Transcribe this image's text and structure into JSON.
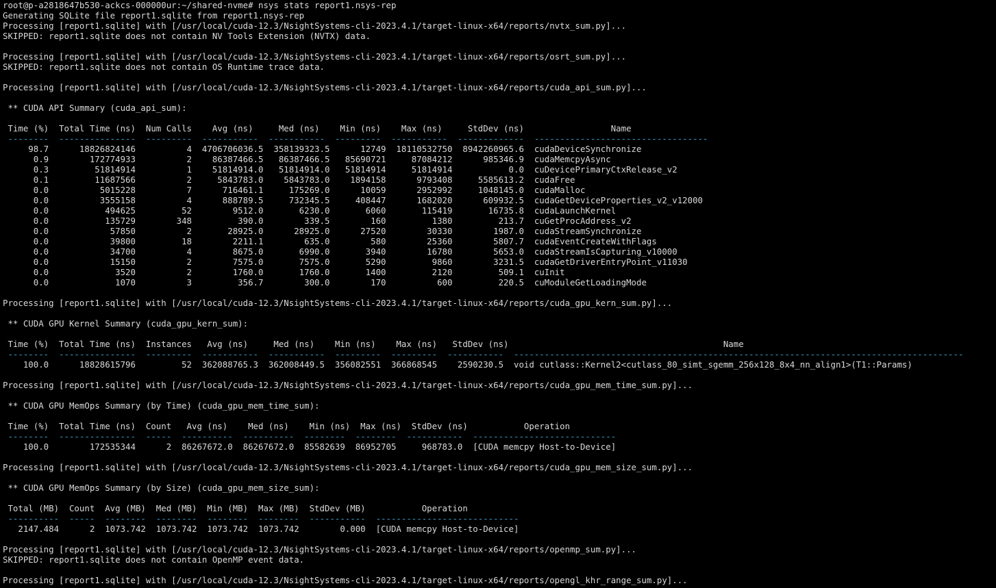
{
  "terminal": {
    "background": "#000000",
    "foreground": "#d9d9d9",
    "dash_color": "#3aa0c8",
    "lines": [
      {
        "text": "root@p-a2818647b530-ackcs-000000ur:~/shared-nvme# nsys stats report1.nsys-rep",
        "style": "normal"
      },
      {
        "text": "Generating SQLite file report1.sqlite from report1.nsys-rep",
        "style": "normal"
      },
      {
        "text": "Processing [report1.sqlite] with [/usr/local/cuda-12.3/NsightSystems-cli-2023.4.1/target-linux-x64/reports/nvtx_sum.py]...",
        "style": "normal"
      },
      {
        "text": "SKIPPED: report1.sqlite does not contain NV Tools Extension (NVTX) data.",
        "style": "normal"
      },
      {
        "text": "",
        "style": "normal"
      },
      {
        "text": "Processing [report1.sqlite] with [/usr/local/cuda-12.3/NsightSystems-cli-2023.4.1/target-linux-x64/reports/osrt_sum.py]...",
        "style": "normal"
      },
      {
        "text": "SKIPPED: report1.sqlite does not contain OS Runtime trace data.",
        "style": "normal"
      },
      {
        "text": "",
        "style": "normal"
      },
      {
        "text": "Processing [report1.sqlite] with [/usr/local/cuda-12.3/NsightSystems-cli-2023.4.1/target-linux-x64/reports/cuda_api_sum.py]...",
        "style": "normal"
      },
      {
        "text": "",
        "style": "normal"
      },
      {
        "text": " ** CUDA API Summary (cuda_api_sum):",
        "style": "normal"
      },
      {
        "text": "",
        "style": "normal"
      },
      {
        "text": " Time (%)  Total Time (ns)  Num Calls    Avg (ns)     Med (ns)    Min (ns)    Max (ns)     StdDev (ns)                 Name",
        "style": "normal"
      },
      {
        "text": " --------  ---------------  ---------  -----------  -----------  ---------  -----------  -------------  ----------------------------------",
        "style": "dash"
      },
      {
        "text": "     98.7      18826824146          4  4706706036.5  358139323.5      12749  18110532750  8942260965.6  cudaDeviceSynchronize",
        "style": "normal"
      },
      {
        "text": "      0.9        172774933          2    86387466.5   86387466.5   85690721     87084212      985346.9  cudaMemcpyAsync",
        "style": "normal"
      },
      {
        "text": "      0.3         51814914          1    51814914.0   51814914.0   51814914     51814914           0.0  cuDevicePrimaryCtxRelease_v2",
        "style": "normal"
      },
      {
        "text": "      0.1         11687566          2     5843783.0    5843783.0    1894158      9793408     5585613.2  cudaFree",
        "style": "normal"
      },
      {
        "text": "      0.0          5015228          7      716461.1     175269.0      10059      2952992     1048145.0  cudaMalloc",
        "style": "normal"
      },
      {
        "text": "      0.0          3555158          4      888789.5     732345.5     408447      1682020      609932.5  cudaGetDeviceProperties_v2_v12000",
        "style": "normal"
      },
      {
        "text": "      0.0           494625         52        9512.0       6230.0       6060       115419       16735.8  cudaLaunchKernel",
        "style": "normal"
      },
      {
        "text": "      0.0           135729        348         390.0        339.5        160         1380         213.7  cuGetProcAddress_v2",
        "style": "normal"
      },
      {
        "text": "      0.0            57850          2       28925.0      28925.0      27520        30330        1987.0  cudaStreamSynchronize",
        "style": "normal"
      },
      {
        "text": "      0.0            39800         18        2211.1        635.0        580        25360        5807.7  cudaEventCreateWithFlags",
        "style": "normal"
      },
      {
        "text": "      0.0            34700          4        8675.0       6990.0       3940        16780        5653.0  cudaStreamIsCapturing_v10000",
        "style": "normal"
      },
      {
        "text": "      0.0            15150          2        7575.0       7575.0       5290         9860        3231.5  cudaGetDriverEntryPoint_v11030",
        "style": "normal"
      },
      {
        "text": "      0.0             3520          2        1760.0       1760.0       1400         2120         509.1  cuInit",
        "style": "normal"
      },
      {
        "text": "      0.0             1070          3         356.7        300.0        170          600         220.5  cuModuleGetLoadingMode",
        "style": "normal"
      },
      {
        "text": "",
        "style": "normal"
      },
      {
        "text": "Processing [report1.sqlite] with [/usr/local/cuda-12.3/NsightSystems-cli-2023.4.1/target-linux-x64/reports/cuda_gpu_kern_sum.py]...",
        "style": "normal"
      },
      {
        "text": "",
        "style": "normal"
      },
      {
        "text": " ** CUDA GPU Kernel Summary (cuda_gpu_kern_sum):",
        "style": "normal"
      },
      {
        "text": "",
        "style": "normal"
      },
      {
        "text": " Time (%)  Total Time (ns)  Instances   Avg (ns)     Med (ns)    Min (ns)    Max (ns)   StdDev (ns)                                          Name",
        "style": "normal"
      },
      {
        "text": " --------  ---------------  ---------  -----------  -----------  ---------  ---------  -----------  ----------------------------------------------------------------------------------------",
        "style": "dash"
      },
      {
        "text": "    100.0      18828615796         52  362088765.3  362008449.5  356082551  366868545    2590230.5  void cutlass::Kernel2<cutlass_80_simt_sgemm_256x128_8x4_nn_align1>(T1::Params)",
        "style": "normal"
      },
      {
        "text": "",
        "style": "normal"
      },
      {
        "text": "Processing [report1.sqlite] with [/usr/local/cuda-12.3/NsightSystems-cli-2023.4.1/target-linux-x64/reports/cuda_gpu_mem_time_sum.py]...",
        "style": "normal"
      },
      {
        "text": "",
        "style": "normal"
      },
      {
        "text": " ** CUDA GPU MemOps Summary (by Time) (cuda_gpu_mem_time_sum):",
        "style": "normal"
      },
      {
        "text": "",
        "style": "normal"
      },
      {
        "text": " Time (%)  Total Time (ns)  Count   Avg (ns)    Med (ns)    Min (ns)  Max (ns)  StdDev (ns)           Operation",
        "style": "normal"
      },
      {
        "text": " --------  ---------------  -----  ----------  ----------  --------  --------  -----------  ----------------------------",
        "style": "dash"
      },
      {
        "text": "    100.0        172535344      2  86267672.0  86267672.0  85582639  86952705     968783.0  [CUDA memcpy Host-to-Device]",
        "style": "normal"
      },
      {
        "text": "",
        "style": "normal"
      },
      {
        "text": "Processing [report1.sqlite] with [/usr/local/cuda-12.3/NsightSystems-cli-2023.4.1/target-linux-x64/reports/cuda_gpu_mem_size_sum.py]...",
        "style": "normal"
      },
      {
        "text": "",
        "style": "normal"
      },
      {
        "text": " ** CUDA GPU MemOps Summary (by Size) (cuda_gpu_mem_size_sum):",
        "style": "normal"
      },
      {
        "text": "",
        "style": "normal"
      },
      {
        "text": " Total (MB)  Count  Avg (MB)  Med (MB)  Min (MB)  Max (MB)  StdDev (MB)           Operation",
        "style": "normal"
      },
      {
        "text": " ----------  -----  --------  --------  --------  --------  -----------  ----------------------------",
        "style": "dash"
      },
      {
        "text": "   2147.484      2  1073.742  1073.742  1073.742  1073.742        0.000  [CUDA memcpy Host-to-Device]",
        "style": "normal"
      },
      {
        "text": "",
        "style": "normal"
      },
      {
        "text": "Processing [report1.sqlite] with [/usr/local/cuda-12.3/NsightSystems-cli-2023.4.1/target-linux-x64/reports/openmp_sum.py]...",
        "style": "normal"
      },
      {
        "text": "SKIPPED: report1.sqlite does not contain OpenMP event data.",
        "style": "normal"
      },
      {
        "text": "",
        "style": "normal"
      },
      {
        "text": "Processing [report1.sqlite] with [/usr/local/cuda-12.3/NsightSystems-cli-2023.4.1/target-linux-x64/reports/opengl_khr_range_sum.py]...",
        "style": "normal"
      }
    ]
  }
}
